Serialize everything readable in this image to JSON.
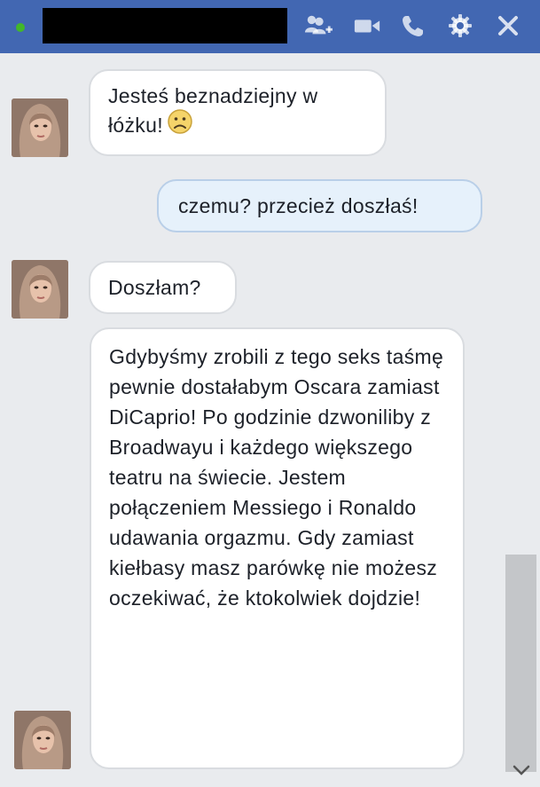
{
  "header": {
    "status_color": "#42b72a",
    "accent_color": "#4267b2",
    "icons": [
      "add-friend-icon",
      "video-call-icon",
      "phone-call-icon",
      "gear-icon",
      "close-icon"
    ]
  },
  "messages": [
    {
      "direction": "incoming",
      "text": "Jesteś beznadziejny w łóżku!",
      "emoji": "sad-face-icon"
    },
    {
      "direction": "outgoing",
      "text": "czemu? przecież doszłaś!"
    },
    {
      "direction": "incoming",
      "text": "Doszłam?"
    },
    {
      "direction": "incoming",
      "text": "Gdybyśmy zrobili z tego seks taśmę pewnie dostałabym Oscara zamiast DiCaprio! Po godzinie dzwoniliby z Broadwayu i każdego większego teatru na świecie. Jestem połączeniem Messiego i Ronaldo udawania orgazmu. Gdy zamiast kiełbasy masz parówkę nie możesz oczekiwać, że ktokolwiek dojdzie!"
    }
  ]
}
